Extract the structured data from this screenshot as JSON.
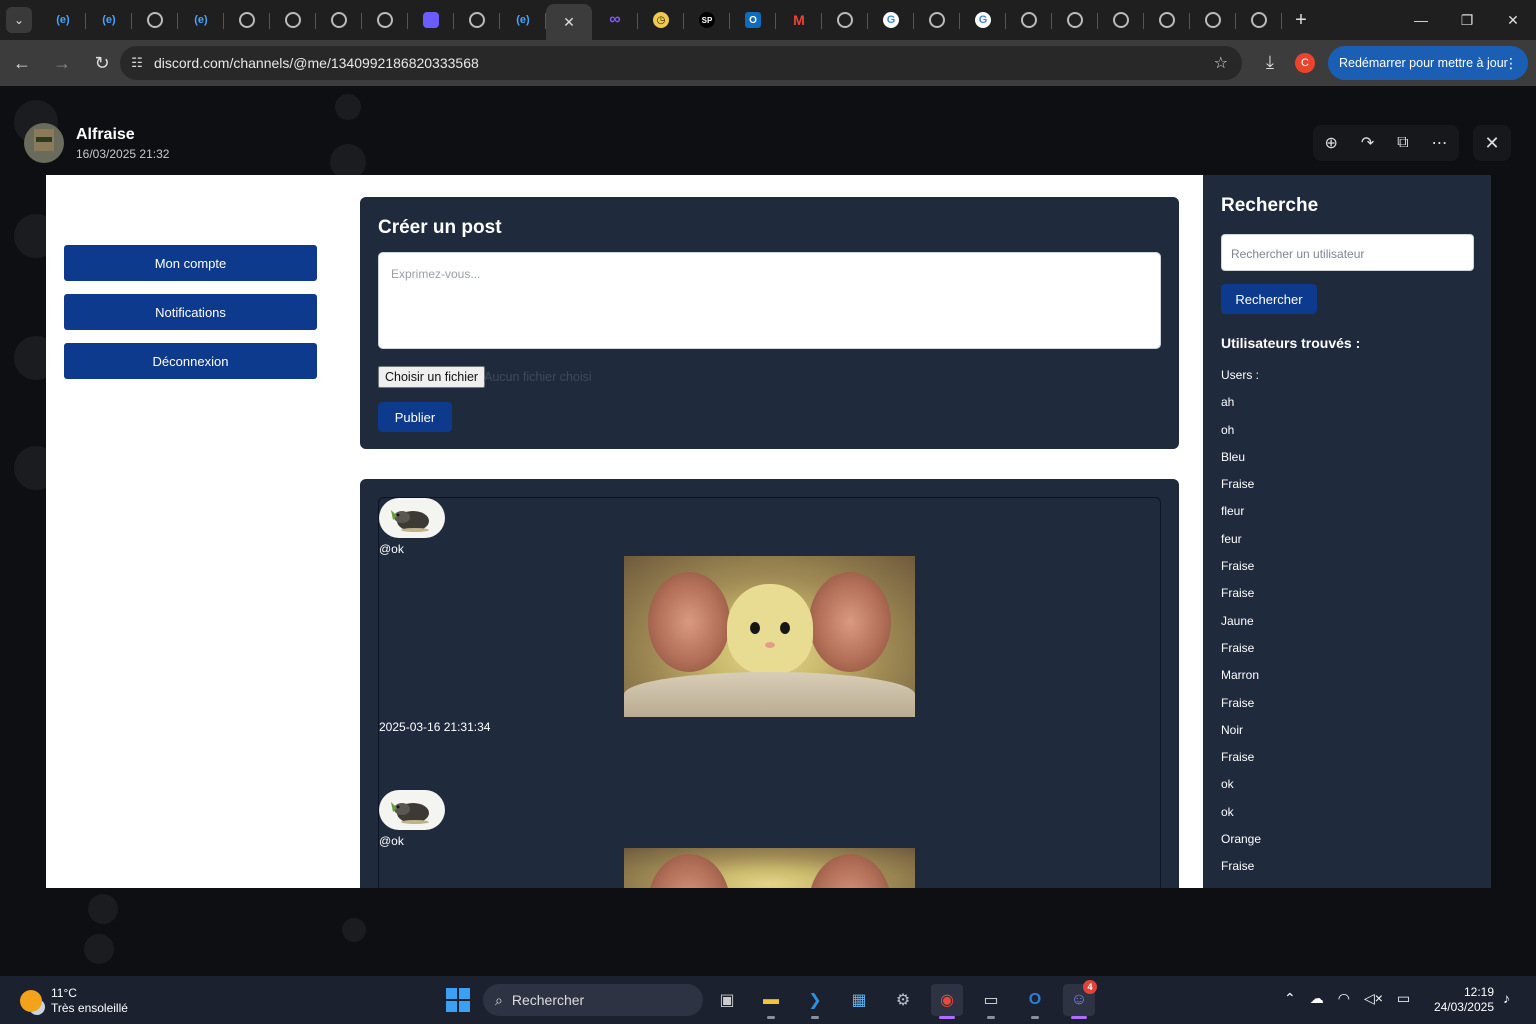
{
  "browser": {
    "address": "discord.com/channels/@me/1340992186820333568",
    "update_label": "Redémarrer pour mettre à jour",
    "profile_initial": "C",
    "tabs": [
      {
        "icon": "e-app-icon",
        "glyph": "(e)"
      },
      {
        "icon": "e-app-icon",
        "glyph": "(e)"
      },
      {
        "icon": "globe-icon",
        "glyph": ""
      },
      {
        "icon": "e-app-icon",
        "glyph": "(e)"
      },
      {
        "icon": "globe-icon",
        "glyph": ""
      },
      {
        "icon": "globe-icon",
        "glyph": ""
      },
      {
        "icon": "globe-icon",
        "glyph": ""
      },
      {
        "icon": "globe-icon",
        "glyph": ""
      },
      {
        "icon": "app-icon",
        "glyph": ""
      },
      {
        "icon": "globe-icon",
        "glyph": ""
      },
      {
        "icon": "e-app-icon",
        "glyph": "(e)"
      },
      {
        "icon": "close-icon",
        "glyph": "✕",
        "active": true
      },
      {
        "icon": "infinity-icon",
        "glyph": "∞"
      },
      {
        "icon": "clock-app-icon",
        "glyph": "◷"
      },
      {
        "icon": "sp-icon",
        "glyph": "SP"
      },
      {
        "icon": "outlook-icon",
        "glyph": "O"
      },
      {
        "icon": "gmail-icon",
        "glyph": "M"
      },
      {
        "icon": "globe-icon",
        "glyph": ""
      },
      {
        "icon": "google-icon",
        "glyph": "G"
      },
      {
        "icon": "globe-icon",
        "glyph": ""
      },
      {
        "icon": "google-icon",
        "glyph": "G"
      },
      {
        "icon": "globe-icon",
        "glyph": ""
      },
      {
        "icon": "globe-icon",
        "glyph": ""
      },
      {
        "icon": "globe-icon",
        "glyph": ""
      },
      {
        "icon": "globe-icon",
        "glyph": ""
      },
      {
        "icon": "globe-icon",
        "glyph": ""
      },
      {
        "icon": "globe-icon",
        "glyph": ""
      }
    ]
  },
  "viewer": {
    "user_name": "Alfraise",
    "timestamp": "16/03/2025 21:32"
  },
  "app": {
    "menu": [
      "Mon compte",
      "Notifications",
      "Déconnexion"
    ],
    "create_title": "Créer un post",
    "textarea_placeholder": "Exprimez-vous...",
    "file_button": "Choisir un fichier",
    "file_status": "Aucun fichier choisi",
    "publish_label": "Publier",
    "posts": [
      {
        "handle": "@ok",
        "date": "2025-03-16 21:31:34"
      },
      {
        "handle": "@ok",
        "date": ""
      }
    ],
    "search": {
      "title": "Recherche",
      "placeholder": "Rechercher un utilisateur",
      "button": "Rechercher",
      "found_label": "Utilisateurs trouvés :",
      "users_label": "Users :",
      "users": [
        "ah",
        "oh",
        "Bleu",
        "Fraise",
        "fleur",
        "feur",
        "Fraise",
        "Fraise",
        "Jaune",
        "Fraise",
        "Marron",
        "Fraise",
        "Noir",
        "Fraise",
        "ok",
        "ok",
        "Orange",
        "Fraise"
      ]
    }
  },
  "taskbar": {
    "temperature": "11°C",
    "weather": "Très ensoleillé",
    "search_label": "Rechercher",
    "time": "12:19",
    "date": "24/03/2025",
    "discord_badge": "4"
  }
}
